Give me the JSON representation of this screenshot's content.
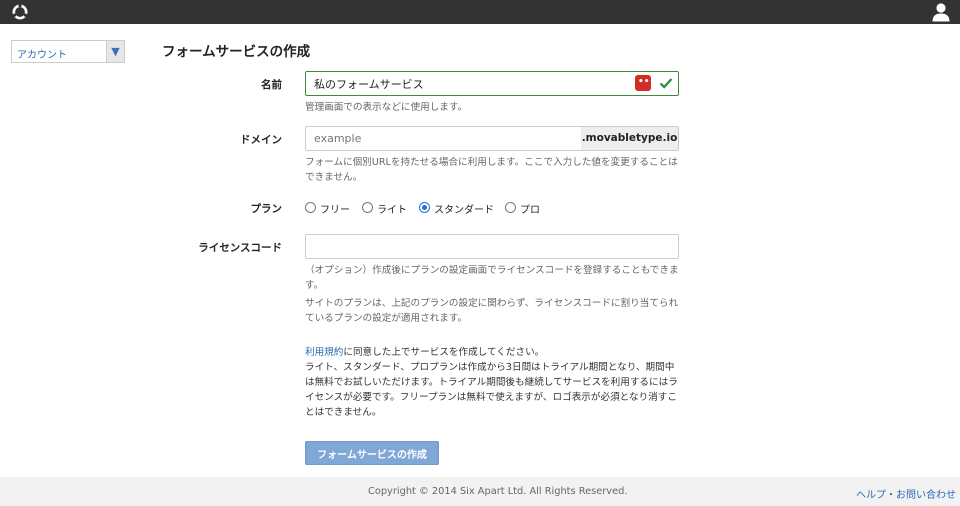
{
  "header": {
    "logo": "logo-ring-icon",
    "user_icon": "user-icon"
  },
  "sidebar": {
    "account_select": "アカウント"
  },
  "page": {
    "title": "フォームサービスの作成"
  },
  "form": {
    "name": {
      "label": "名前",
      "value": "私のフォームサービス",
      "help": "管理画面での表示などに使用します。"
    },
    "domain": {
      "label": "ドメイン",
      "placeholder": "example",
      "suffix": ".movabletype.io",
      "help": "フォームに個別URLを持たせる場合に利用します。ここで入力した値を変更することはできません。"
    },
    "plan": {
      "label": "プラン",
      "options": [
        "フリー",
        "ライト",
        "スタンダード",
        "プロ"
      ],
      "selected": "スタンダード"
    },
    "license": {
      "label": "ライセンスコード",
      "value": "",
      "help1": "（オプション）作成後にプランの設定画面でライセンスコードを登録することもできます。",
      "help2": "サイトのプランは、上記のプランの設定に関わらず、ライセンスコードに割り当てられているプランの設定が適用されます。"
    },
    "notice": {
      "terms_link": "利用規約",
      "text1": "に同意した上でサービスを作成してください。",
      "text2": "ライト、スタンダード、プロプランは作成から3日間はトライアル期間となり、期間中は無料でお試しいただけます。トライアル期間後も継続してサービスを利用するにはライセンスが必要です。フリープランは無料で使えますが、ロゴ表示が必須となり消すことはできません。"
    },
    "submit_label": "フォームサービスの作成"
  },
  "footer": {
    "copyright": "Copyright © 2014 Six Apart Ltd. All Rights Reserved.",
    "help_link": "ヘルプ・お問い合わせ"
  },
  "colors": {
    "topbar": "#333333",
    "accent": "#2a6ab5",
    "button": "#7fa8d6",
    "valid": "#3c8c3c"
  }
}
